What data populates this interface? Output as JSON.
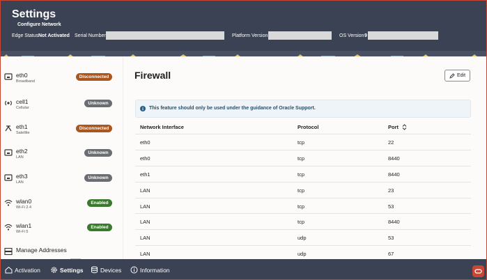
{
  "header": {
    "title": "Settings",
    "subtitle": "Configure Network",
    "edge_status_label": "Edge Status",
    "edge_status_value": "Not Activated",
    "serial_label": "Serial Number",
    "platform_label": "Platform Version",
    "os_label": "OS Version",
    "os_value": "9"
  },
  "colors": {
    "header_bg": "#3b4253",
    "disconnected": "#a9561f",
    "unknown": "#6a6d72",
    "enabled": "#3a7a2e",
    "accent": "#c74634"
  },
  "sidebar": {
    "items": [
      {
        "name": "eth0",
        "sub": "Broadband",
        "status": "Disconnected",
        "icon": "ethernet-icon"
      },
      {
        "name": "cell1",
        "sub": "Cellular",
        "status": "Unknown",
        "icon": "cellular-icon"
      },
      {
        "name": "eth1",
        "sub": "Satellite",
        "status": "Disconnected",
        "icon": "satellite-icon"
      },
      {
        "name": "eth2",
        "sub": "LAN",
        "status": "Unknown",
        "icon": "ethernet-icon"
      },
      {
        "name": "eth3",
        "sub": "LAN",
        "status": "Unknown",
        "icon": "ethernet-icon"
      },
      {
        "name": "wlan0",
        "sub": "Wi-Fi 2.4",
        "status": "Enabled",
        "icon": "wifi-icon"
      },
      {
        "name": "wlan1",
        "sub": "Wi-Fi 5",
        "status": "Enabled",
        "icon": "wifi-icon"
      }
    ],
    "manage_label": "Manage Addresses"
  },
  "main": {
    "title": "Firewall",
    "edit_label": "Edit",
    "info_text": "This feature should only be used under the guidance of Oracle Support.",
    "columns": [
      "Network Interface",
      "Protocol",
      "Port"
    ],
    "rows": [
      [
        "eth0",
        "tcp",
        "22"
      ],
      [
        "eth0",
        "tcp",
        "8440"
      ],
      [
        "eth1",
        "tcp",
        "8440"
      ],
      [
        "LAN",
        "tcp",
        "23"
      ],
      [
        "LAN",
        "tcp",
        "53"
      ],
      [
        "LAN",
        "tcp",
        "8440"
      ],
      [
        "LAN",
        "udp",
        "53"
      ],
      [
        "LAN",
        "udp",
        "67"
      ]
    ]
  },
  "bottom_nav": {
    "tabs": [
      {
        "label": "Activation",
        "icon": "home-icon"
      },
      {
        "label": "Settings",
        "icon": "gear-icon",
        "active": true
      },
      {
        "label": "Devices",
        "icon": "database-icon"
      },
      {
        "label": "Information",
        "icon": "info-icon"
      }
    ]
  }
}
